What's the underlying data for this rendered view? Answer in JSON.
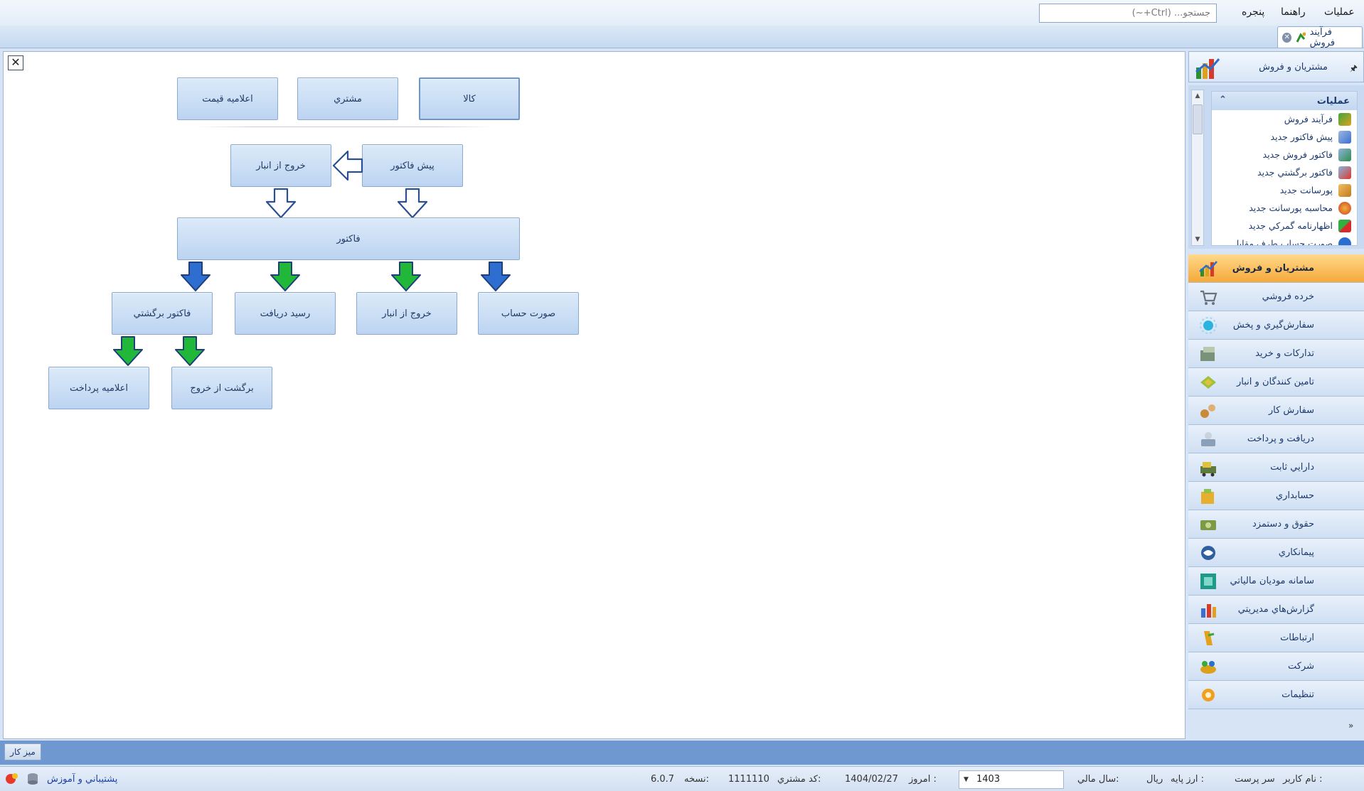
{
  "menubar": {
    "items": [
      "عملیات",
      "راهنما",
      "پنجره"
    ],
    "search_placeholder": "جستجو... (Ctrl+~)"
  },
  "tabs": [
    {
      "label": "فرآیند فروش"
    }
  ],
  "flow": {
    "top_row": [
      "کالا",
      "مشتري",
      "اعلاميه قيمت"
    ],
    "pre_invoice": "پیش فاکتور",
    "warehouse_exit_top": "خروج از انبار",
    "invoice": "فاکتور",
    "mid_row": [
      "صورت حساب",
      "خروج از انبار",
      "رسيد دريافت",
      "فاکتور برگشتي"
    ],
    "bottom_row": [
      "برگشت از خروج",
      "اعلاميه پرداخت"
    ]
  },
  "right_panel": {
    "header": "مشتريان و فروش",
    "ops_title": "عملیات",
    "ops": [
      {
        "label": "فرآیند فروش",
        "icon": "sales-process-icon"
      },
      {
        "label": "پیش فاکتور جدید",
        "icon": "pre-invoice-icon"
      },
      {
        "label": "فاکتور فروش جدید",
        "icon": "sales-invoice-icon"
      },
      {
        "label": "فاکتور برگشتي جدید",
        "icon": "return-invoice-icon"
      },
      {
        "label": "پورسانت جدید",
        "icon": "commission-icon"
      },
      {
        "label": "محاسبه پورسانت جدید",
        "icon": "commission-calc-icon"
      },
      {
        "label": "اظهارنامه گمرکي جدید",
        "icon": "customs-icon"
      },
      {
        "label": "صورت حساب طرف مقابل",
        "icon": "statement-icon"
      }
    ],
    "modules": [
      {
        "label": "مشتريان و فروش",
        "icon": "customers-sales-icon",
        "color": "#e8572b",
        "active": true
      },
      {
        "label": "خرده فروشي",
        "icon": "retail-cart-icon",
        "color": "#8a8f9a"
      },
      {
        "label": "سفارش‌گيري و پخش",
        "icon": "distribution-icon",
        "color": "#2bb3e0"
      },
      {
        "label": "تدارکات و خرید",
        "icon": "procurement-icon",
        "color": "#6e8a6e"
      },
      {
        "label": "تامين کنندگان و انبار",
        "icon": "suppliers-warehouse-icon",
        "color": "#9fc23b"
      },
      {
        "label": "سفارش کار",
        "icon": "work-order-icon",
        "color": "#c98a3a"
      },
      {
        "label": "دريافت و پرداخت",
        "icon": "payment-icon",
        "color": "#8aa0b8"
      },
      {
        "label": "دارايي ثابت",
        "icon": "fixed-asset-icon",
        "color": "#5e7a3c"
      },
      {
        "label": "حسابداري",
        "icon": "accounting-icon",
        "color": "#e6b02e"
      },
      {
        "label": "حقوق و دستمزد",
        "icon": "payroll-icon",
        "color": "#7c9a48"
      },
      {
        "label": "پيمانکاري",
        "icon": "contracting-icon",
        "color": "#2f5f9e"
      },
      {
        "label": "سامانه موديان مالياتي",
        "icon": "tax-system-icon",
        "color": "#1f9a8a"
      },
      {
        "label": "گزارش‌هاي مديريتي",
        "icon": "reports-icon",
        "color": "#3a6fd0"
      },
      {
        "label": "ارتباطات",
        "icon": "communications-icon",
        "color": "#e2a21c"
      },
      {
        "label": "شرکت",
        "icon": "company-icon",
        "color": "#d9a21a"
      },
      {
        "label": "تنظيمات",
        "icon": "settings-icon",
        "color": "#f0a020"
      }
    ]
  },
  "taskbar": {
    "desktop_label": "ميز کار"
  },
  "status": {
    "user_label": "نام کاربر :",
    "user_value": "سر پرست",
    "currency_label": "ارز پایه :",
    "currency_value": "ريال",
    "fiscal_label": "سال مالي:",
    "fiscal_value": "1403",
    "today_label": "امروز :",
    "today_value": "1404/02/27",
    "customer_label": "کد مشتري:",
    "customer_value": "1111110",
    "version_label": "نسخه:",
    "version_value": "6.0.7",
    "support": "پشتيباني و آموزش"
  }
}
